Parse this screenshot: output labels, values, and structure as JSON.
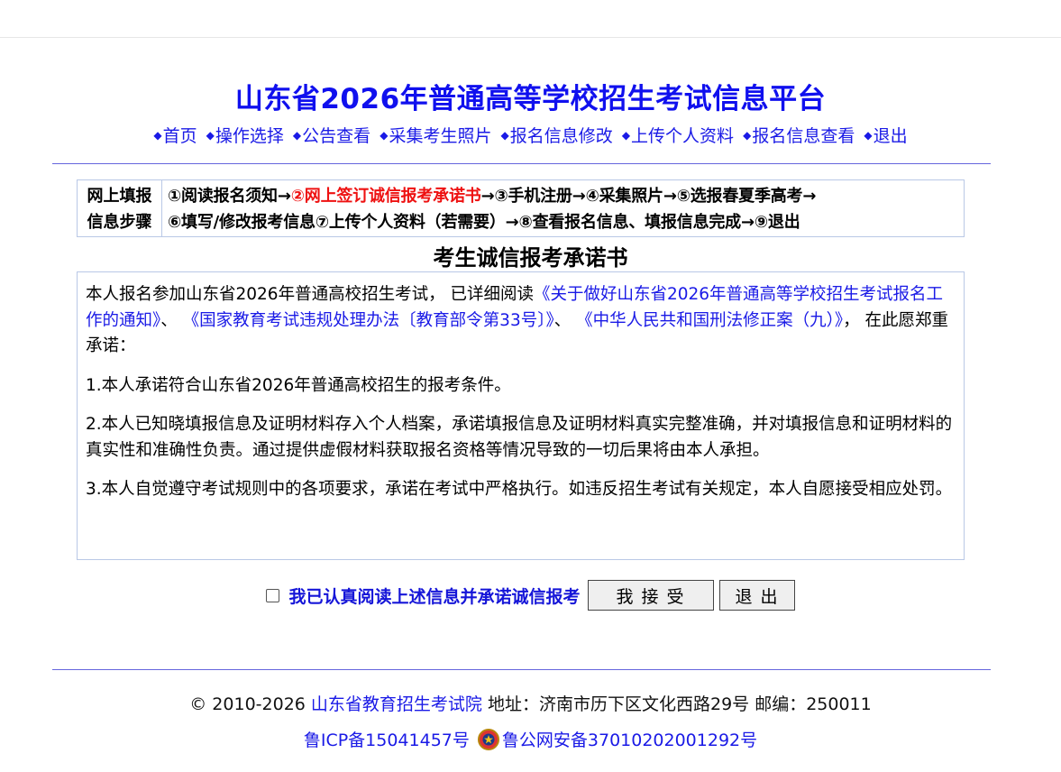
{
  "header": {
    "title": "山东省2026年普通高等学校招生考试信息平台"
  },
  "nav": [
    {
      "bullet": "◆",
      "label": "首页"
    },
    {
      "bullet": "◆",
      "label": "操作选择"
    },
    {
      "bullet": "◆",
      "label": "公告查看"
    },
    {
      "bullet": "◆",
      "label": "采集考生照片"
    },
    {
      "bullet": "◆",
      "label": "报名信息修改"
    },
    {
      "bullet": "◆",
      "label": "上传个人资料"
    },
    {
      "bullet": "◆",
      "label": "报名信息查看"
    },
    {
      "bullet": "◆",
      "label": "退出"
    }
  ],
  "steps": {
    "label_line1": "网上填报",
    "label_line2": "信息步骤",
    "s1": "①阅读报名须知→",
    "s2": "②网上签订诚信报考承诺书",
    "s3": "→③手机注册→④采集照片→⑤选报春夏季高考→",
    "s4": "⑥填写/修改报考信息⑦上传个人资料（若需要）→⑧查看报名信息、填报信息完成→⑨退出"
  },
  "pledge": {
    "title": "考生诚信报考承诺书",
    "intro_prefix": "本人报名参加山东省2026年普通高校招生考试， 已详细阅读",
    "doc1": "《关于做好山东省2026年普通高等学校招生考试报名工作的通知》",
    "sep1": "、",
    "doc2": "《国家教育考试违规处理办法〔教育部令第33号〕》",
    "sep2": "、",
    "doc3": "《中华人民共和国刑法修正案（九）》",
    "intro_suffix": "， 在此愿郑重承诺：",
    "item1": "1.本人承诺符合山东省2026年普通高校招生的报考条件。",
    "item2": "2.本人已知晓填报信息及证明材料存入个人档案，承诺填报信息及证明材料真实完整准确，并对填报信息和证明材料的真实性和准确性负责。通过提供虚假材料获取报名资格等情况导致的一切后果将由本人承担。",
    "item3": "3.本人自觉遵守考试规则中的各项要求，承诺在考试中严格执行。如违反招生考试有关规定，本人自愿接受相应处罚。"
  },
  "agree": {
    "checked": false,
    "label": "我已认真阅读上述信息并承诺诚信报考",
    "accept_button": "我接受",
    "exit_button": "退出"
  },
  "footer": {
    "copyright": "© 2010-2026 ",
    "org": "山东省教育招生考试院",
    "address": " 地址：济南市历下区文化西路29号 邮编：250011",
    "icp": "鲁ICP备15041457号",
    "police": "鲁公网安备37010202001292号"
  },
  "colors": {
    "link": "#1a1ae6",
    "title": "#1010ee",
    "highlight_step": "#ee1111",
    "box_border": "#b9c8e6"
  }
}
